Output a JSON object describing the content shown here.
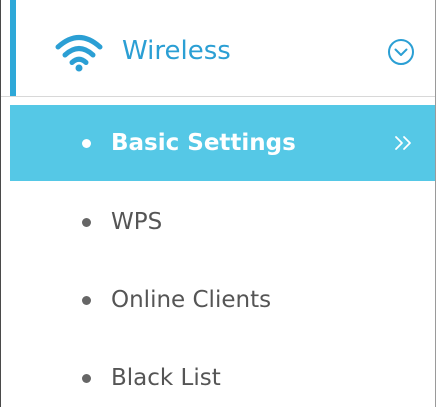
{
  "section": {
    "title": "Wireless",
    "icon": "wifi-icon",
    "toggle_icon": "chevron-down-circle-icon"
  },
  "colors": {
    "accent": "#2ea8d8",
    "active_background": "#55c8e6",
    "title_text": "#2b9fd4",
    "item_text": "#555555"
  },
  "menu": {
    "items": [
      {
        "label": "Basic Settings",
        "active": true,
        "indicator_icon": "double-chevron-right-icon"
      },
      {
        "label": "WPS",
        "active": false
      },
      {
        "label": "Online Clients",
        "active": false
      },
      {
        "label": "Black List",
        "active": false
      }
    ]
  }
}
